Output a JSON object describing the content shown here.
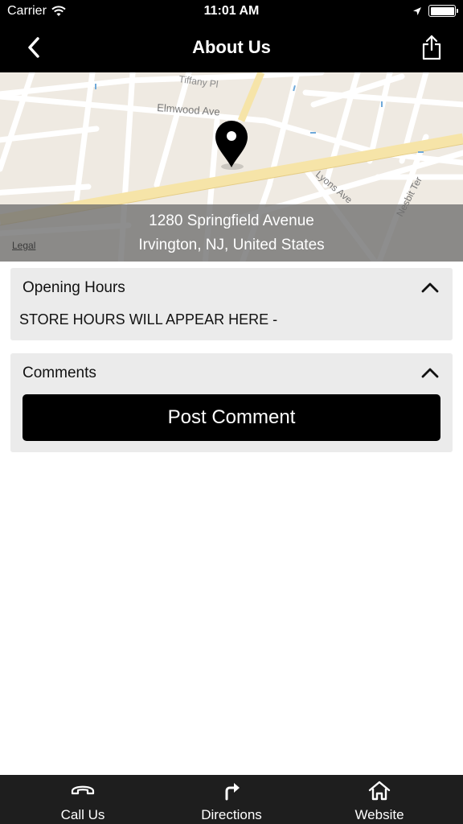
{
  "status_bar": {
    "carrier": "Carrier",
    "time": "11:01 AM"
  },
  "nav": {
    "title": "About Us"
  },
  "map": {
    "streets": [
      "Tiffany Pl",
      "Elmwood Ave",
      "Lyons Ave",
      "Nesbit Ter"
    ],
    "address_line1": "1280 Springfield Avenue",
    "address_line2": "Irvington, NJ, United States",
    "legal": "Legal"
  },
  "opening_hours": {
    "title": "Opening Hours",
    "text": "STORE HOURS WILL APPEAR HERE  -"
  },
  "comments": {
    "title": "Comments",
    "post_button": "Post Comment"
  },
  "tabs": [
    {
      "label": "Call Us",
      "icon": "phone-icon"
    },
    {
      "label": "Directions",
      "icon": "directions-icon"
    },
    {
      "label": "Website",
      "icon": "home-icon"
    }
  ],
  "colors": {
    "bar_background": "#000000",
    "card_background": "#ebebeb",
    "tab_bar_background": "#1e1e1e",
    "map_background": "#efeae2",
    "road_major": "#f6e4a8"
  }
}
